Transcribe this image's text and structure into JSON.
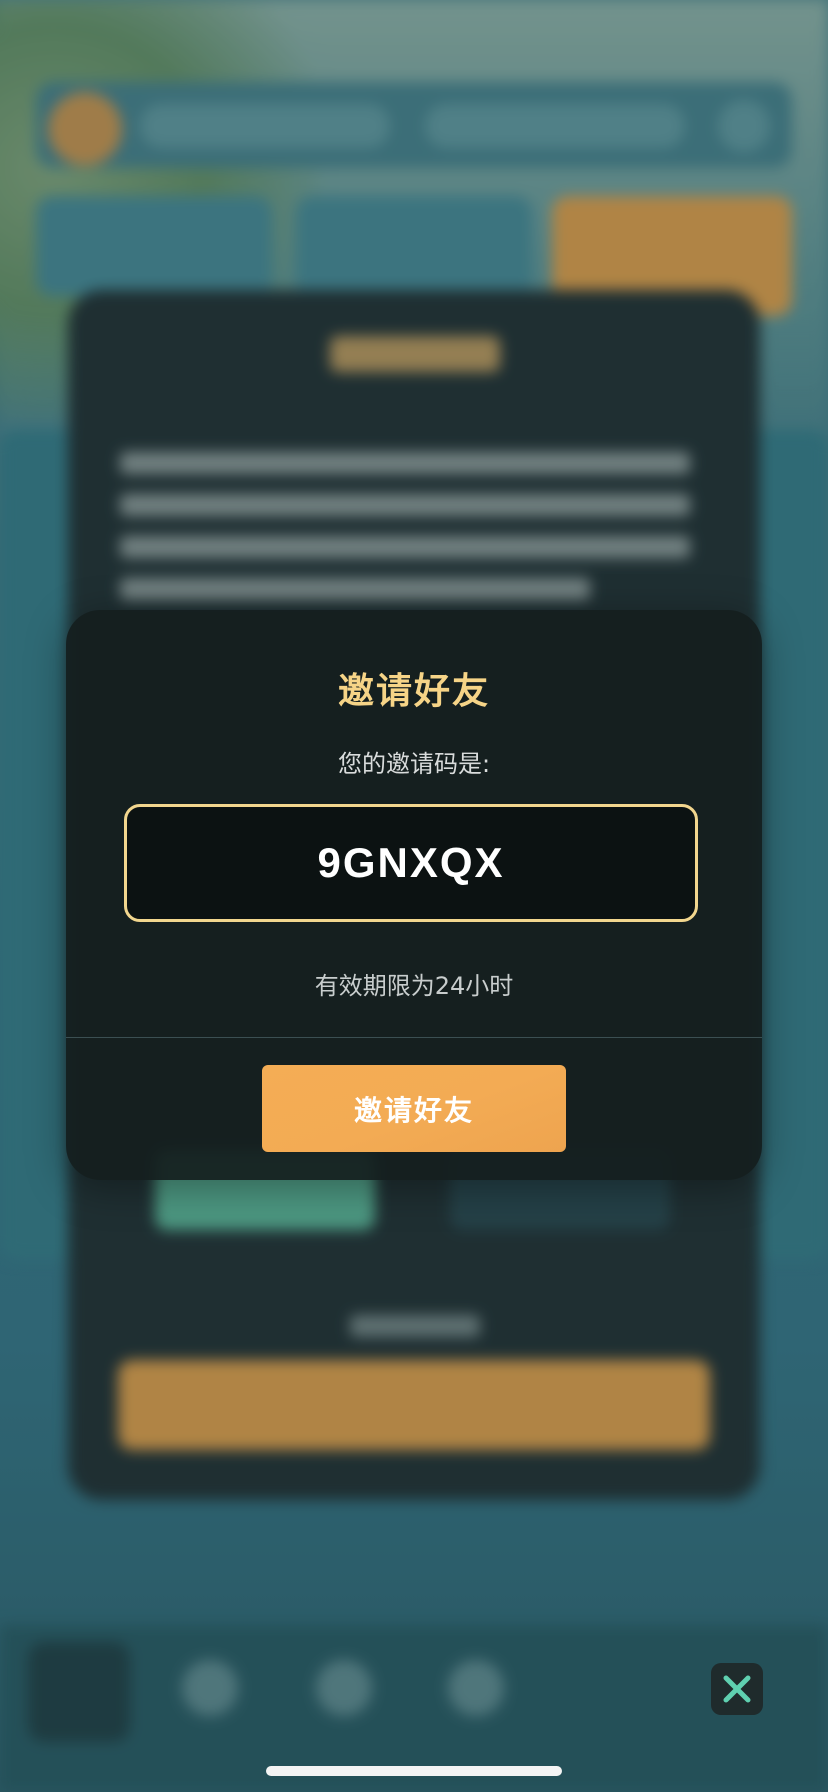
{
  "modal": {
    "title": "邀请好友",
    "subtitle": "您的邀请码是:",
    "invite_code": "9GNXQX",
    "validity_text": "有效期限为24小时",
    "invite_button_label": "邀请好友"
  },
  "colors": {
    "title_gold": "#f6d487",
    "code_border": "#f2d68e",
    "button_orange": "#f3ab54",
    "close_icon_teal": "#5fd0b0"
  },
  "icons": {
    "close": "close-icon"
  }
}
